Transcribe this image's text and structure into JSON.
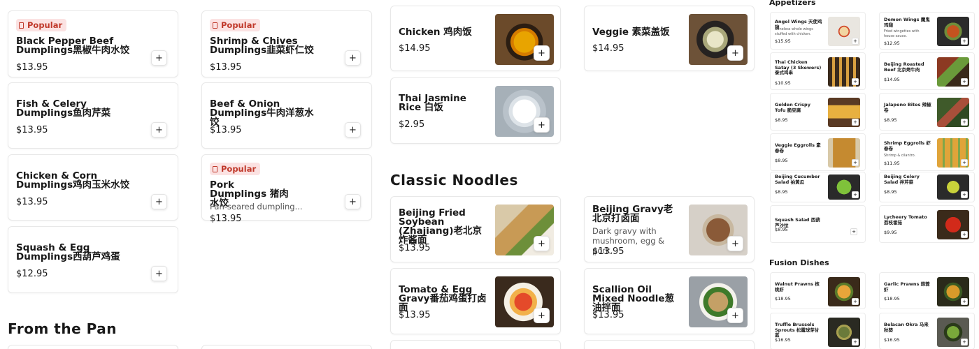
{
  "col1": [
    {
      "badge": "Popular",
      "title": "Black Pepper Beef Dumplings黑椒牛肉水饺",
      "price": "$13.95"
    },
    {
      "title": "Fish & Celery Dumplings鱼肉芹菜",
      "price": "$13.95"
    },
    {
      "title": "Chicken & Corn Dumplings鸡肉玉米水饺",
      "price": "$13.95"
    },
    {
      "title": "Squash & Egg Dumplings西葫芦鸡蛋",
      "price": "$12.95"
    }
  ],
  "col2": [
    {
      "badge": "Popular",
      "title": "Shrimp & Chives Dumplings韭菜虾仁饺",
      "price": "$13.95"
    },
    {
      "title": "Beef & Onion Dumplings牛肉洋葱水饺",
      "price": "$13.95"
    },
    {
      "badge": "Popular",
      "title": "Pork Dumplings 猪肉水饺",
      "desc": "Pan-seared dumpling...",
      "price": "$13.95"
    }
  ],
  "from_pan_title": "From the Pan",
  "classic_noodles_title": "Classic Noodles",
  "col3": [
    {
      "title": "Chicken 鸡肉饭",
      "price": "$14.95"
    },
    {
      "title": "Thai Jasmine Rice 白饭",
      "price": "$2.95"
    },
    {
      "title": "Beijing Fried Soybean (Zhajiang)老北京炸酱面",
      "price": "$13.95"
    },
    {
      "title": "Tomato & Egg Gravy番茄鸡蛋打卤面",
      "price": "$13.95"
    }
  ],
  "col4": [
    {
      "title": "Veggie 素菜盖饭",
      "price": "$14.95"
    },
    {
      "title": "Beijing Gravy老北京打卤面",
      "desc": "Dark gravy with mushroom, egg & pork.",
      "price": "$13.95"
    },
    {
      "title": "Scallion Oil Mixed Noodle葱油拌面",
      "price": "$13.95"
    }
  ],
  "appetizers_title": "Appetizers",
  "fusion_title": "Fusion Dishes",
  "appetizers_left": [
    {
      "title": "Angel Wings 天使鸡翅",
      "desc": "Boneless whole wings stuffed with chicken.",
      "price": "$15.95"
    },
    {
      "title": "Thai Chicken Satay (3 Skewers) 泰式鸡串",
      "price": "$10.95"
    },
    {
      "title": "Golden Crispy Tofu 脆豆腐",
      "price": "$8.95"
    },
    {
      "title": "Veggie Eggrolls 素春卷",
      "price": "$8.95"
    },
    {
      "title": "Beijing Cucumber Salad 拍黄瓜",
      "price": "$8.95"
    },
    {
      "title": "Squash Salad 西葫芦沙拉",
      "price": "$8.95"
    }
  ],
  "appetizers_right": [
    {
      "title": "Demon Wings 魔鬼鸡翅",
      "desc": "Fried wingettes with house sauce.",
      "price": "$12.95"
    },
    {
      "title": "Beijing Roasted Beef 北京烤牛肉",
      "price": "$14.95"
    },
    {
      "title": "Jalapeno Bites 辣椒卷",
      "price": "$8.95"
    },
    {
      "title": "Shrimp Eggrolls 虾春卷",
      "desc": "Shrimp & cilantro.",
      "price": "$11.95"
    },
    {
      "title": "Beijing Celery Salad 拌芹菜",
      "price": "$8.95"
    },
    {
      "title": "Lycheery Tomato 荔枝番茄",
      "price": "$9.95"
    }
  ],
  "fusion_left": [
    {
      "title": "Walnut Prawns 核桃虾",
      "price": "$18.95"
    },
    {
      "title": "Truffle Brussels Sprouts 松露球芽甘蓝",
      "price": "$16.95"
    }
  ],
  "fusion_right": [
    {
      "title": "Garlic Prawns 蒜蓉虾",
      "price": "$18.95"
    },
    {
      "title": "Belacan Okra 马来秋葵",
      "price": "$16.95"
    }
  ],
  "add_label": "+",
  "colors": {
    "badge_bg": "#fbe2e2",
    "badge_text": "#c0392b"
  },
  "icons": {
    "popular": "fire-icon",
    "add": "plus-icon"
  }
}
